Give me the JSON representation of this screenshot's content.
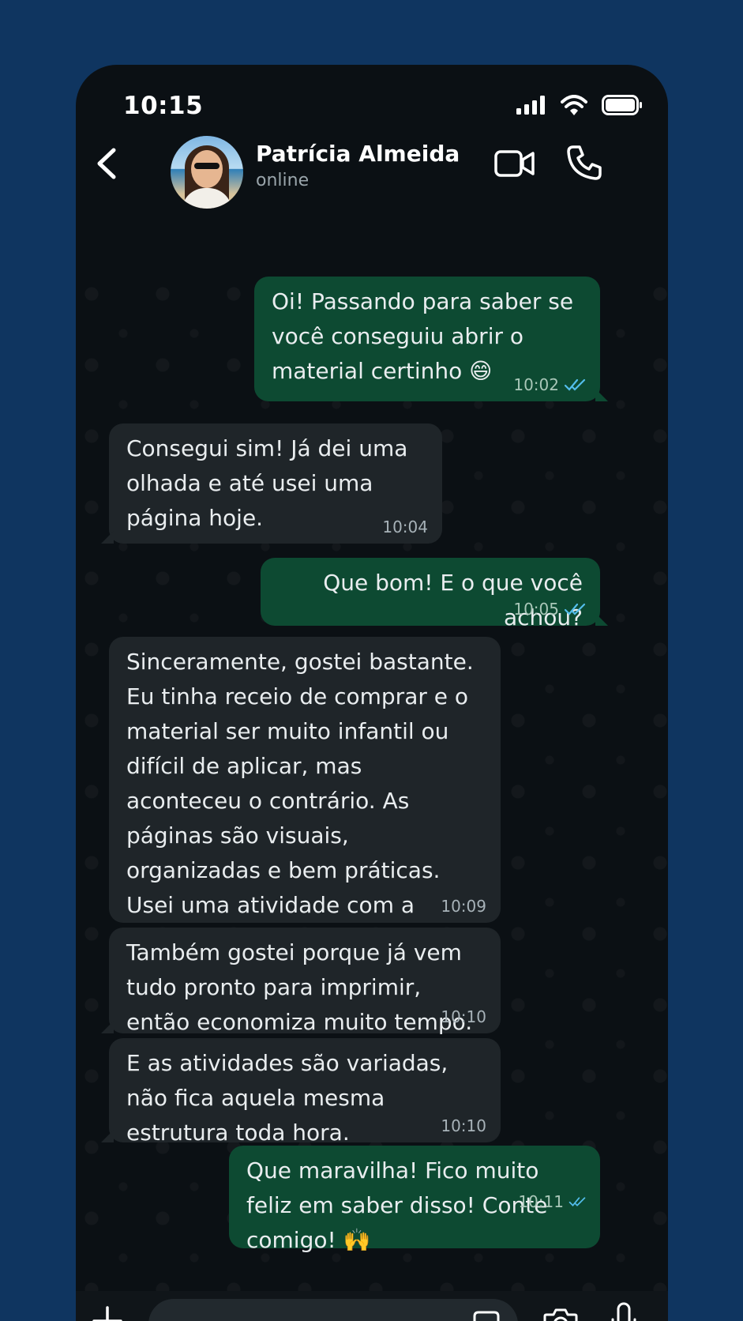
{
  "status_bar": {
    "time": "10:15"
  },
  "header": {
    "contact_name": "Patrícia Almeida",
    "contact_status": "online"
  },
  "messages": [
    {
      "direction": "out",
      "text": "Oi! Passando para saber se você conseguiu abrir o material certinho 😄",
      "time": "10:02",
      "read": true
    },
    {
      "direction": "in",
      "text": "Consegui sim! Já dei uma olhada e até usei uma página hoje.",
      "time": "10:04"
    },
    {
      "direction": "out",
      "text": "Que bom! E o que você achou?",
      "time": "10:05",
      "read": true
    },
    {
      "direction": "in",
      "text": "Sinceramente, gostei bastante. Eu tinha receio de comprar e o material ser muito infantil ou difícil de aplicar, mas aconteceu o contrário. As páginas são visuais, organizadas e bem práticas. Usei uma atividade com a turma e eles entenderam melhor o conteúdo.",
      "time": "10:09"
    },
    {
      "direction": "in",
      "text": "Também gostei porque já vem tudo pronto para imprimir, então economiza muito tempo.",
      "time": "10:10"
    },
    {
      "direction": "in",
      "text": "E as atividades são variadas, não fica aquela mesma estrutura toda hora.",
      "time": "10:10"
    },
    {
      "direction": "out",
      "text": "Que maravilha! Fico muito feliz em saber disso! Conte comigo! 🙌",
      "time": "10:11",
      "read": true
    }
  ],
  "composer": {
    "placeholder": ""
  },
  "colors": {
    "outgoing_bubble": "#0d4a32",
    "incoming_bubble": "#1f2529",
    "read_ticks": "#53bdeb",
    "background": "#0f3560"
  },
  "icons": [
    "back-arrow-icon",
    "video-call-icon",
    "phone-icon",
    "plus-icon",
    "sticker-icon",
    "camera-icon",
    "microphone-icon",
    "signal-icon",
    "wifi-icon",
    "battery-icon",
    "double-check-icon"
  ]
}
